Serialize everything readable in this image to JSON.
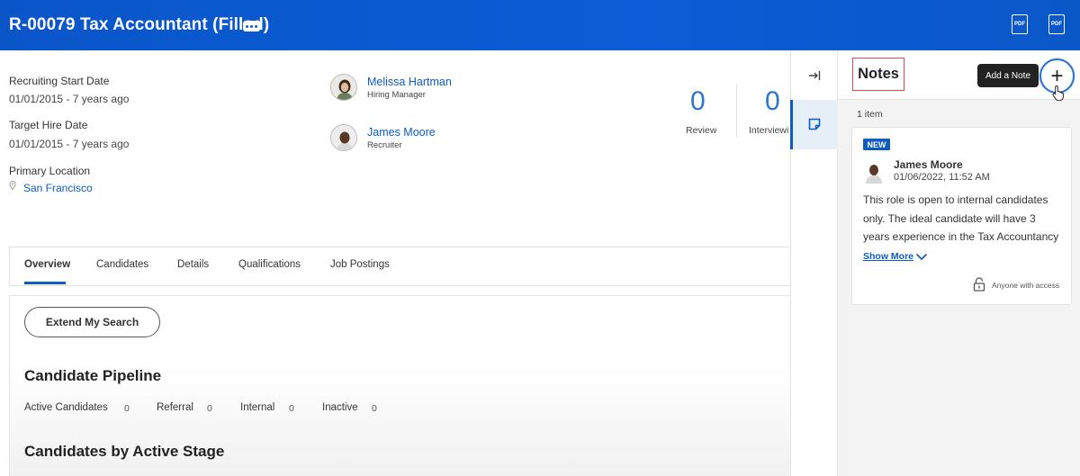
{
  "header": {
    "title": "R-00079 Tax Accountant (Filled)",
    "more_icon": "ellipsis-icon",
    "pdf_label": "PDF"
  },
  "info": {
    "recruiting_start_label": "Recruiting Start Date",
    "recruiting_start_value": "01/01/2015 - 7 years ago",
    "target_hire_label": "Target Hire Date",
    "target_hire_value": "01/01/2015 - 7 years ago",
    "location_label": "Primary Location",
    "location_value": "San Francisco"
  },
  "people": [
    {
      "name": "Melissa Hartman",
      "role": "Hiring Manager"
    },
    {
      "name": "James Moore",
      "role": "Recruiter"
    }
  ],
  "stats": [
    {
      "value": "0",
      "label": "Review"
    },
    {
      "value": "0",
      "label": "Interviewi"
    }
  ],
  "tabs": [
    "Overview",
    "Candidates",
    "Details",
    "Qualifications",
    "Job Postings"
  ],
  "main": {
    "extend_button": "Extend My Search",
    "pipeline_title": "Candidate Pipeline",
    "pipeline": [
      {
        "label": "Active Candidates",
        "value": "0"
      },
      {
        "label": "Referral",
        "value": "0"
      },
      {
        "label": "Internal",
        "value": "0"
      },
      {
        "label": "Inactive",
        "value": "0"
      }
    ],
    "stage_title": "Candidates by Active Stage"
  },
  "notes": {
    "title": "Notes",
    "tooltip": "Add a Note",
    "add_symbol": "+",
    "count": "1 item",
    "card": {
      "badge": "NEW",
      "author": "James Moore",
      "timestamp": "01/06/2022, 11:52 AM",
      "body": "This role is open to internal candidates only. The ideal candidate will have 3 years experience in the Tax Accountancy",
      "show_more": "Show More",
      "access": "Anyone with access"
    }
  },
  "colors": {
    "header_blue": "#0b5cd6",
    "link_blue": "#0c5dbf",
    "highlight_red": "#e0474c"
  }
}
